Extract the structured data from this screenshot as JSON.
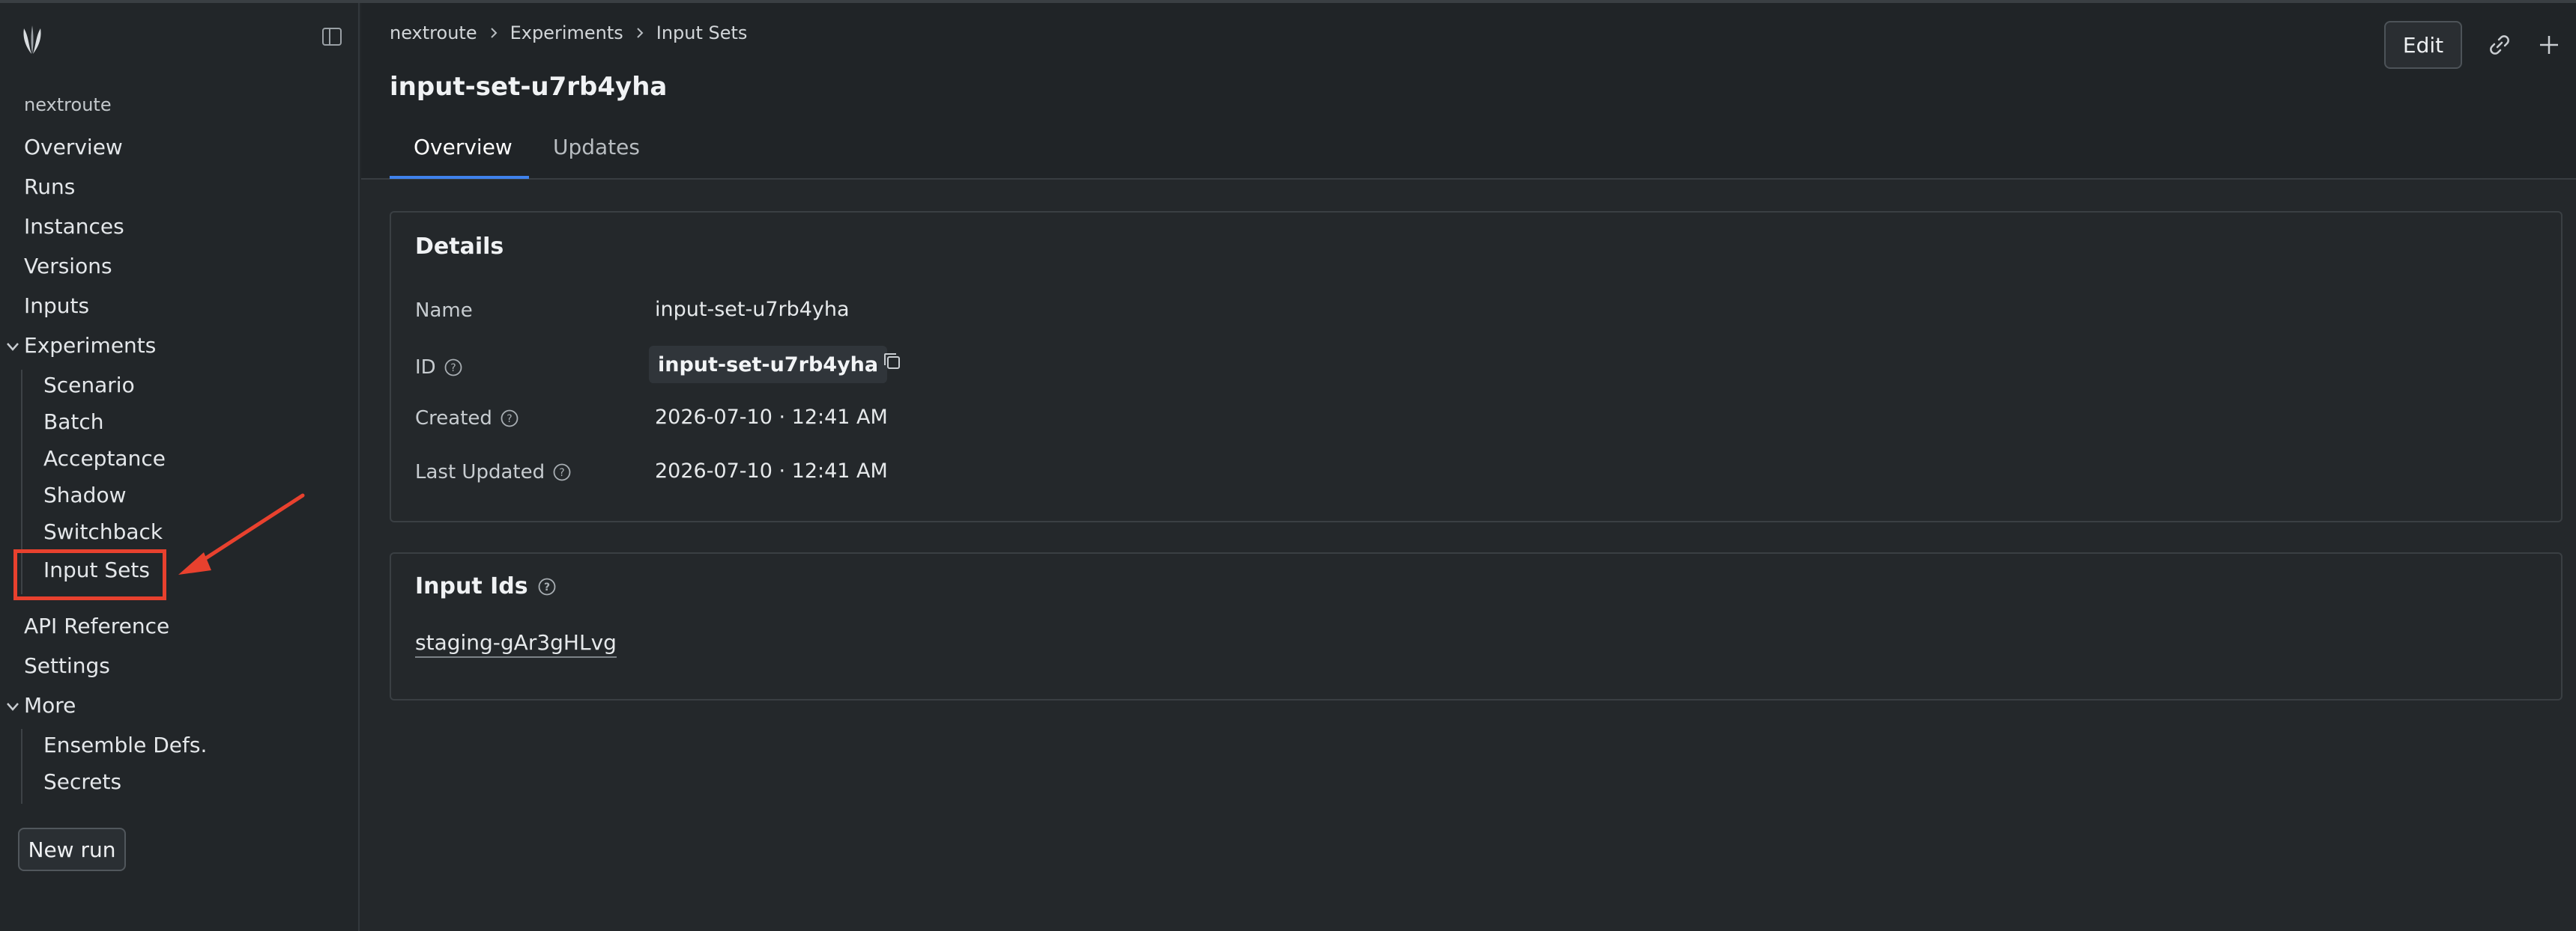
{
  "sidebar": {
    "app_name": "nextroute",
    "items": [
      {
        "label": "Overview"
      },
      {
        "label": "Runs"
      },
      {
        "label": "Instances"
      },
      {
        "label": "Versions"
      },
      {
        "label": "Inputs"
      }
    ],
    "experiments": {
      "label": "Experiments",
      "children": [
        "Scenario",
        "Batch",
        "Acceptance",
        "Shadow",
        "Switchback",
        "Input Sets"
      ]
    },
    "api_reference": "API Reference",
    "settings": "Settings",
    "more": {
      "label": "More",
      "children": [
        "Ensemble Defs.",
        "Secrets"
      ]
    },
    "new_run_label": "New run"
  },
  "breadcrumb": [
    "nextroute",
    "Experiments",
    "Input Sets"
  ],
  "page": {
    "title": "input-set-u7rb4yha",
    "tabs": [
      "Overview",
      "Updates"
    ],
    "active_tab": "Overview",
    "edit_label": "Edit"
  },
  "details": {
    "title": "Details",
    "rows": {
      "name": {
        "label": "Name",
        "value": "input-set-u7rb4yha"
      },
      "id": {
        "label": "ID",
        "value": "input-set-u7rb4yha"
      },
      "created": {
        "label": "Created",
        "value": "2026-07-10 · 12:41 AM"
      },
      "last_updated": {
        "label": "Last Updated",
        "value": "2026-07-10 · 12:41 AM"
      }
    }
  },
  "input_ids": {
    "title": "Input Ids",
    "items": [
      "staging-gAr3gHLvg"
    ]
  },
  "colors": {
    "accent": "#3f82ec",
    "annotation": "#e8412e"
  },
  "icons": [
    "logo-icon",
    "sidebar-toggle-icon",
    "chevron-down-icon",
    "chevron-right-icon",
    "help-icon",
    "copy-icon",
    "link-icon",
    "plus-icon"
  ]
}
